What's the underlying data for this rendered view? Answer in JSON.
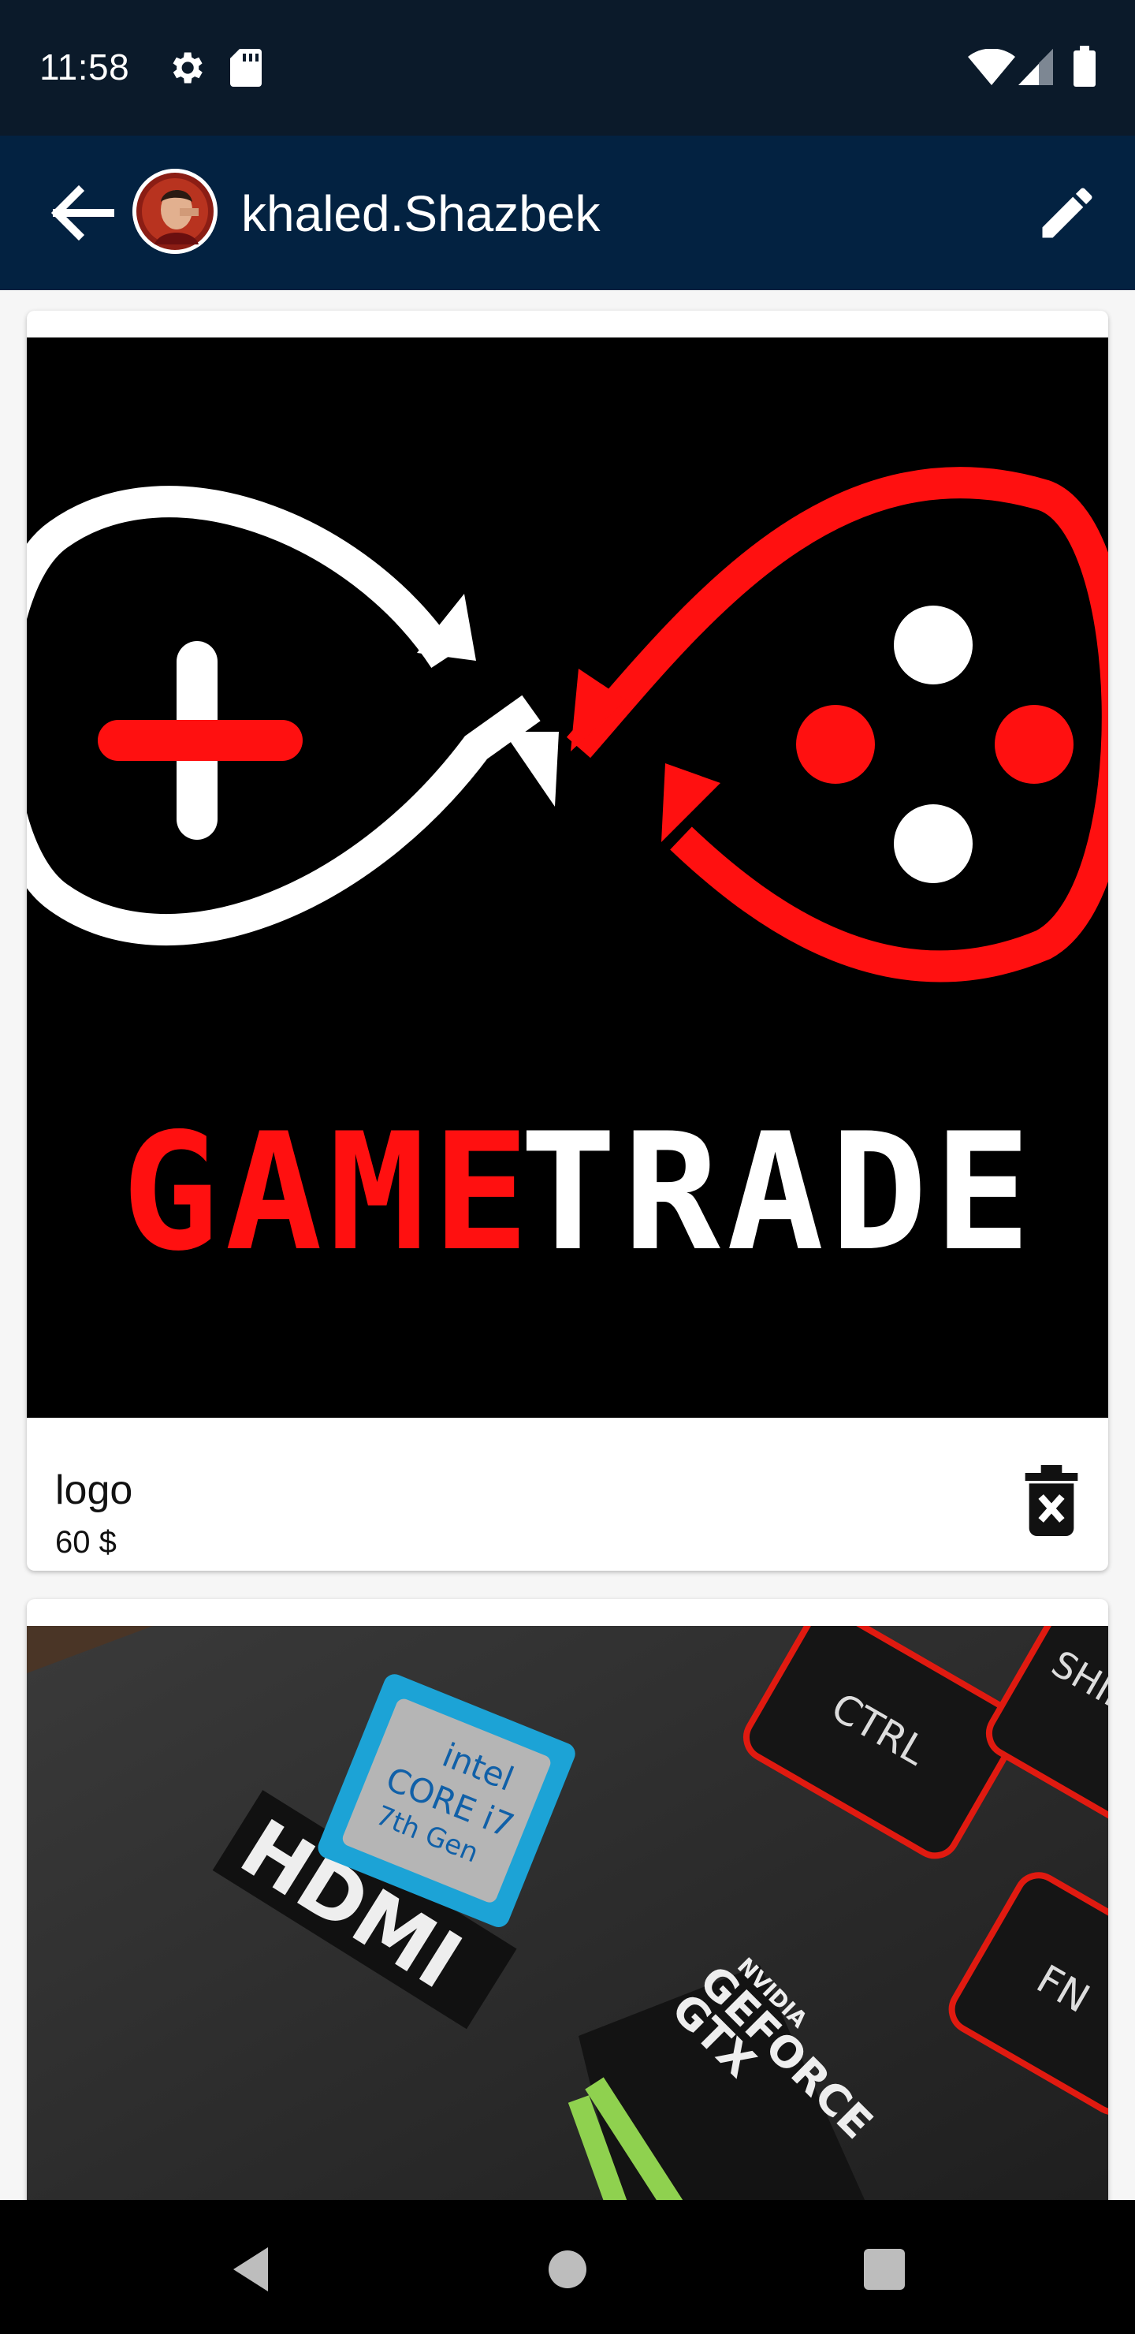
{
  "status_bar": {
    "time": "11:58",
    "icons": [
      "gear-icon",
      "sd-card-icon",
      "wifi-icon",
      "signal-icon",
      "battery-icon"
    ]
  },
  "toolbar": {
    "title": "khaled.Shazbek",
    "back_icon": "arrow-back-icon",
    "edit_icon": "pencil-icon",
    "background": "#032241"
  },
  "items": [
    {
      "title": "logo",
      "price": "60 $",
      "image_text": {
        "part1": "GAME",
        "part2": "TRADE"
      }
    },
    {
      "title": "",
      "price": "",
      "image_text": {
        "hdmi": "HDMI",
        "intel": "intel",
        "core": "CORE i7",
        "gen": "7th Gen",
        "nvidia": "NVIDIA",
        "geforce": "GEFORCE",
        "gtx": "GTX",
        "ctrl": "CTRL",
        "fn": "FN",
        "shift": "SHIF"
      }
    }
  ],
  "colors": {
    "accent_red": "#ff1010",
    "statusbar": "#0b1a2a"
  },
  "nav_bar": [
    "back-triangle-icon",
    "home-circle-icon",
    "recents-square-icon"
  ]
}
